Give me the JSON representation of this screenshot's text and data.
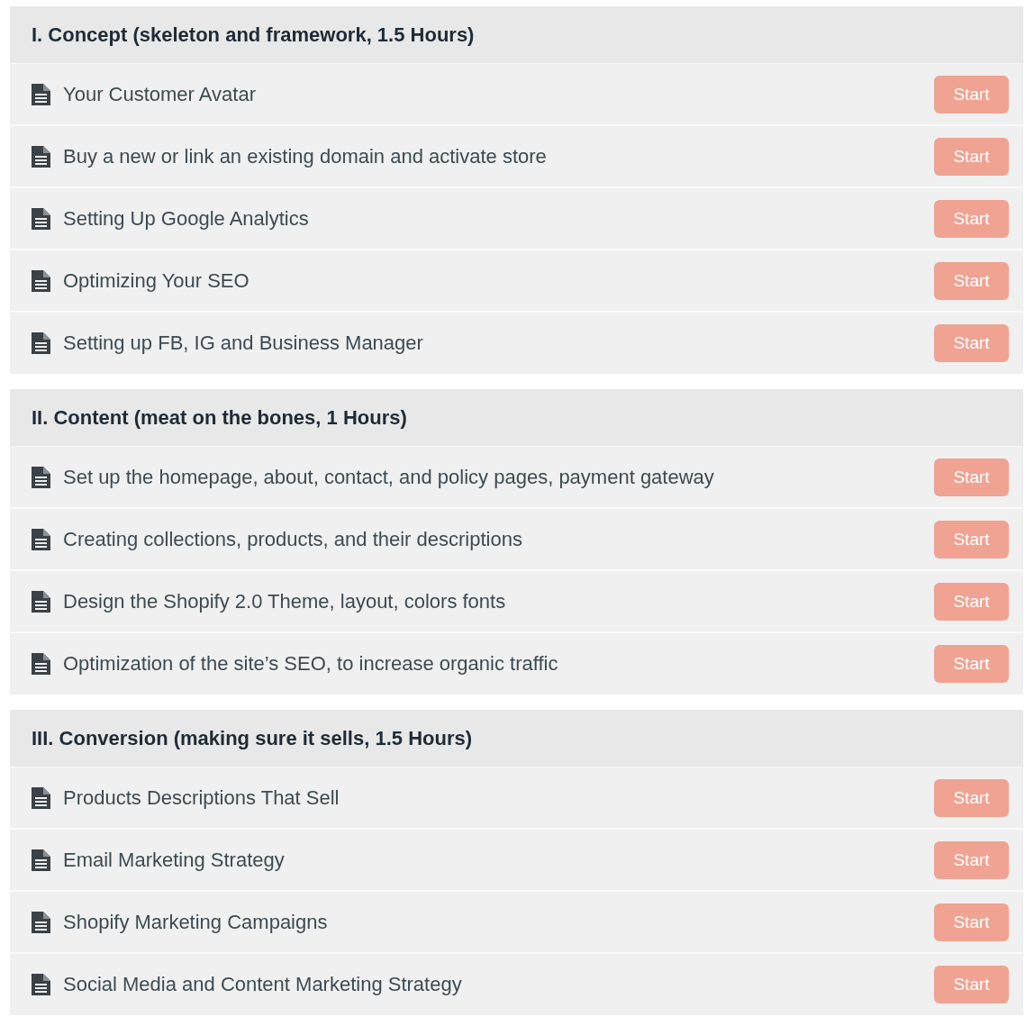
{
  "sections": [
    {
      "title": "I. Concept (skeleton and framework, 1.5 Hours)",
      "lessons": [
        {
          "title": "Your Customer Avatar",
          "button": "Start"
        },
        {
          "title": "Buy a new or link an existing domain and activate store",
          "button": "Start"
        },
        {
          "title": "Setting Up Google Analytics",
          "button": "Start"
        },
        {
          "title": "Optimizing Your SEO",
          "button": "Start"
        },
        {
          "title": "Setting up FB, IG and Business Manager",
          "button": "Start"
        }
      ]
    },
    {
      "title": "II. Content (meat on the bones, 1 Hours)",
      "lessons": [
        {
          "title": "Set up the homepage, about, contact, and policy pages, payment gateway",
          "button": "Start"
        },
        {
          "title": "Creating collections, products, and their descriptions",
          "button": "Start"
        },
        {
          "title": "Design the Shopify 2.0 Theme, layout, colors fonts",
          "button": "Start"
        },
        {
          "title": "Optimization of the site’s SEO, to increase organic traffic",
          "button": "Start"
        }
      ]
    },
    {
      "title": "III. Conversion (making sure it sells, 1.5 Hours)",
      "lessons": [
        {
          "title": "Products Descriptions That Sell",
          "button": "Start"
        },
        {
          "title": "Email Marketing Strategy",
          "button": "Start"
        },
        {
          "title": "Shopify Marketing Campaigns",
          "button": "Start"
        },
        {
          "title": "Social Media and Content Marketing Strategy",
          "button": "Start"
        }
      ]
    }
  ]
}
